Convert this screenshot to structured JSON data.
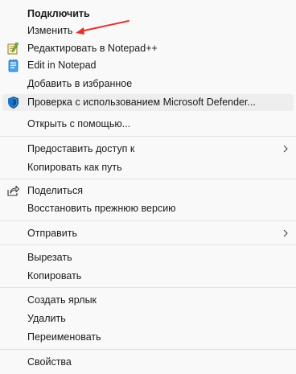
{
  "menu": {
    "items": [
      {
        "label": "Подключить"
      },
      {
        "label": "Изменить"
      },
      {
        "label": "Редактировать в Notepad++"
      },
      {
        "label": "Edit in Notepad"
      },
      {
        "label": "Добавить в избранное"
      },
      {
        "label": "Проверка с использованием Microsoft Defender..."
      },
      {
        "label": "Открыть с помощью..."
      },
      {
        "label": "Предоставить доступ к"
      },
      {
        "label": "Копировать как путь"
      },
      {
        "label": "Поделиться"
      },
      {
        "label": "Восстановить прежнюю версию"
      },
      {
        "label": "Отправить"
      },
      {
        "label": "Вырезать"
      },
      {
        "label": "Копировать"
      },
      {
        "label": "Создать ярлык"
      },
      {
        "label": "Удалить"
      },
      {
        "label": "Переименовать"
      },
      {
        "label": "Свойства"
      }
    ]
  },
  "icons": {
    "notepad_plus_plus": "notepad-plus-plus-icon",
    "notepad": "notepad-icon",
    "defender": "microsoft-defender-shield-icon",
    "share": "share-icon",
    "submenu": "chevron-right-icon"
  },
  "colors": {
    "annotation_arrow": "#e8312a",
    "defender_shield": "#1a73c9"
  }
}
